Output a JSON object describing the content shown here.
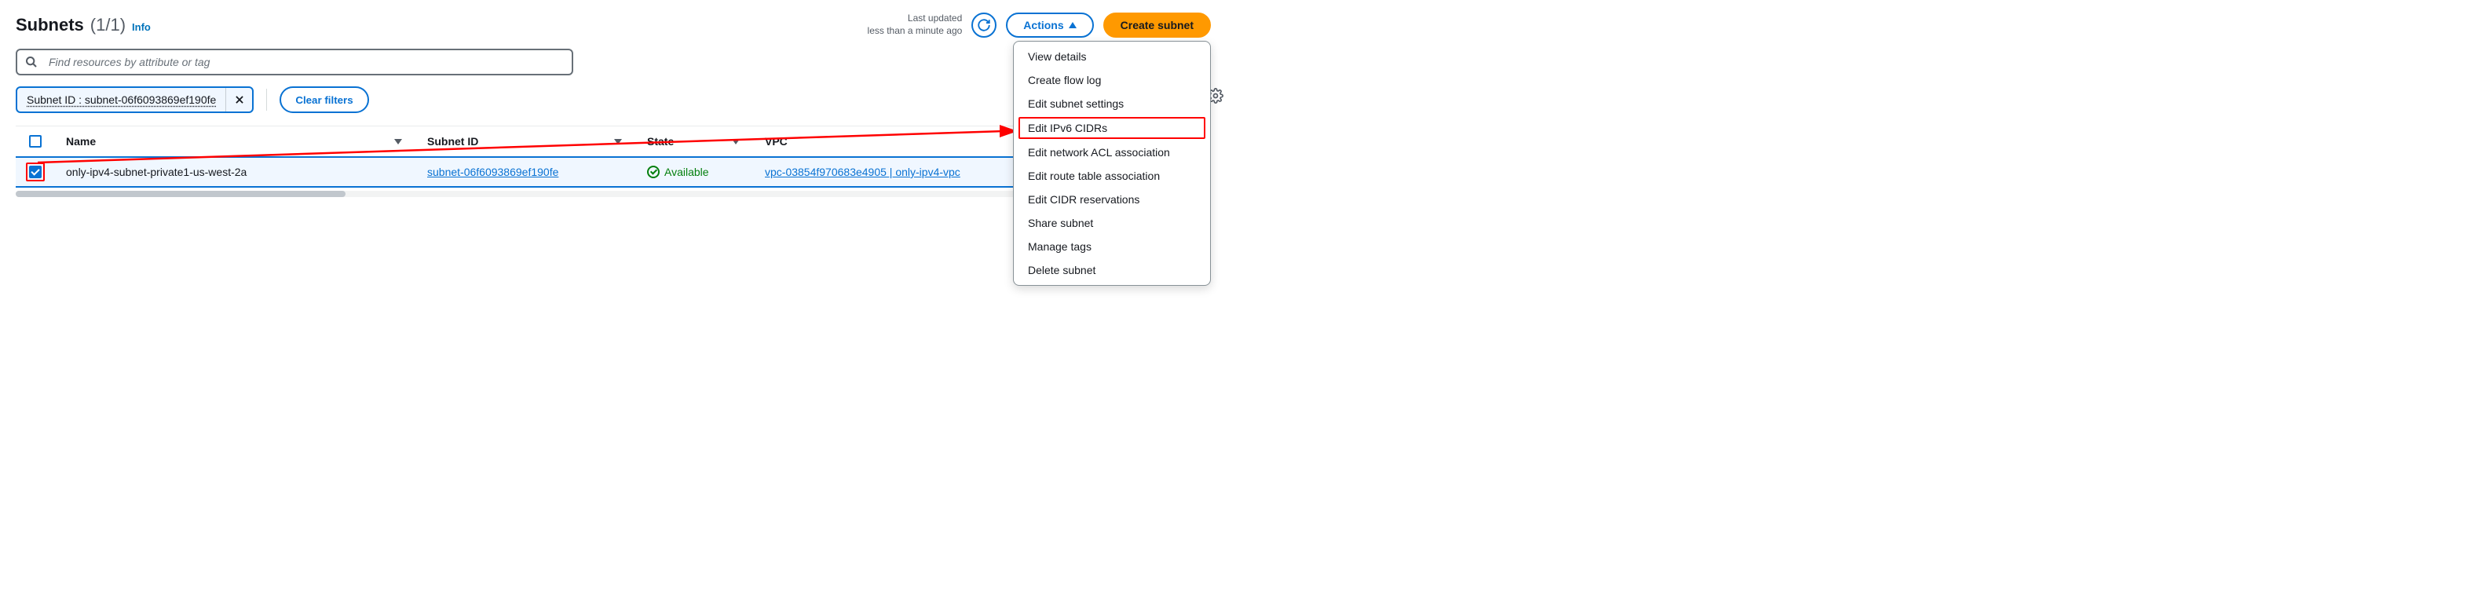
{
  "header": {
    "title": "Subnets",
    "count": "(1/1)",
    "info": "Info",
    "last_updated_label": "Last updated",
    "last_updated_value": "less than a minute ago",
    "actions_label": "Actions",
    "create_label": "Create subnet"
  },
  "search": {
    "placeholder": "Find resources by attribute or tag"
  },
  "filter": {
    "chip_text": "Subnet ID : subnet-06f6093869ef190fe",
    "clear_label": "Clear filters"
  },
  "table": {
    "columns": {
      "name": "Name",
      "subnet_id": "Subnet ID",
      "state": "State",
      "vpc": "VPC"
    },
    "rows": [
      {
        "checked": true,
        "name": "only-ipv4-subnet-private1-us-west-2a",
        "subnet_id": "subnet-06f6093869ef190fe",
        "state": "Available",
        "vpc": "vpc-03854f970683e4905 | only-ipv4-vpc"
      }
    ]
  },
  "dropdown": {
    "items": [
      "View details",
      "Create flow log",
      "Edit subnet settings",
      "Edit IPv6 CIDRs",
      "Edit network ACL association",
      "Edit route table association",
      "Edit CIDR reservations",
      "Share subnet",
      "Manage tags",
      "Delete subnet"
    ],
    "highlighted_index": 3
  }
}
